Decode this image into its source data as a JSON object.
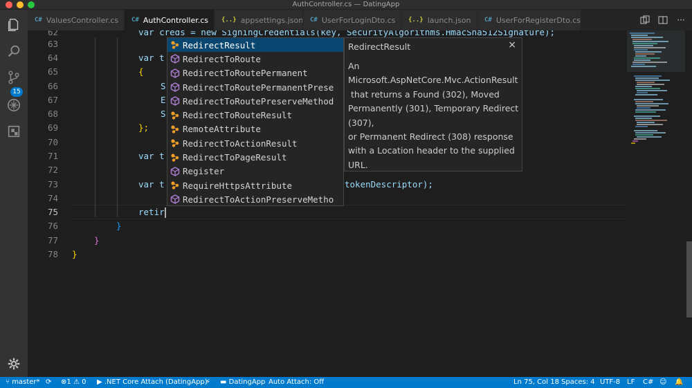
{
  "window": {
    "title": "AuthController.cs — DatingApp"
  },
  "activity_bar": {
    "items": [
      {
        "icon": "files-icon"
      },
      {
        "icon": "search-icon"
      },
      {
        "icon": "source-control-icon",
        "badge": "15"
      },
      {
        "icon": "debug-icon"
      },
      {
        "icon": "extensions-icon"
      }
    ],
    "settings_icon": "gear-icon"
  },
  "tabs": [
    {
      "label": "ValuesController.cs",
      "type": "C#",
      "active": false
    },
    {
      "label": "AuthController.cs",
      "type": "C#",
      "active": true
    },
    {
      "label": "appsettings.json",
      "type": "{..}",
      "active": false
    },
    {
      "label": "UserForLoginDto.cs",
      "type": "C#",
      "active": false
    },
    {
      "label": "launch.json",
      "type": "{..}",
      "active": false
    },
    {
      "label": "UserForRegisterDto.cs",
      "type": "C#",
      "active": false
    }
  ],
  "editor": {
    "line_numbers": [
      "62",
      "63",
      "64",
      "65",
      "66",
      "67",
      "68",
      "69",
      "70",
      "71",
      "72",
      "73",
      "74",
      "75",
      "76",
      "77",
      "78"
    ],
    "current_line": "75",
    "code": {
      "l62": "var creds = new SigningCredentials(key, SecurityAlgorithms.HmacSha512Signature);",
      "l64_a": "var t",
      "l65_a": "S",
      "l66_a": "E",
      "l67_a": "S",
      "l68_a": "};",
      "l70_a": "var t",
      "l72_a": "var t",
      "l72_b": "tokenDescriptor);",
      "l74_a": "retir",
      "l75_a": "}",
      "l76_a": "}",
      "l77_a": "}",
      "brace_open": "{"
    }
  },
  "suggestions": [
    {
      "label": "RedirectResult",
      "kind": "class",
      "selected": true
    },
    {
      "label": "RedirectToRoute",
      "kind": "method",
      "selected": false
    },
    {
      "label": "RedirectToRoutePermanent",
      "kind": "method",
      "selected": false
    },
    {
      "label": "RedirectToRoutePermanentPrese",
      "kind": "method",
      "selected": false
    },
    {
      "label": "RedirectToRoutePreserveMethod",
      "kind": "method",
      "selected": false
    },
    {
      "label": "RedirectToRouteResult",
      "kind": "class",
      "selected": false
    },
    {
      "label": "RemoteAttribute",
      "kind": "class",
      "selected": false
    },
    {
      "label": "RedirectToActionResult",
      "kind": "class",
      "selected": false
    },
    {
      "label": "RedirectToPageResult",
      "kind": "class",
      "selected": false
    },
    {
      "label": "Register",
      "kind": "method",
      "selected": false
    },
    {
      "label": "RequireHttpsAttribute",
      "kind": "class",
      "selected": false
    },
    {
      "label": "RedirectToActionPreserveMetho",
      "kind": "method",
      "selected": false
    }
  ],
  "docs": {
    "title": "RedirectResult",
    "close_label": "×",
    "lines": [
      "An",
      "Microsoft.AspNetCore.Mvc.ActionResult",
      " that returns a Found (302), Moved",
      "Permanently (301), Temporary Redirect",
      "(307),",
      "or Permanent Redirect (308) response",
      "with a Location header to the supplied",
      "URL."
    ]
  },
  "status_bar": {
    "branch": "master*",
    "errors": "1",
    "warnings": "0",
    "debug_target": ".NET Core Attach (DatingApp)",
    "project": "DatingApp",
    "auto_attach": "Auto Attach: Off",
    "position": "Ln 75, Col 18",
    "spaces": "Spaces: 4",
    "encoding": "UTF-8",
    "eol": "LF",
    "language": "C#"
  },
  "colors": {
    "accent": "#007acc",
    "editor_bg": "#1e1e1e",
    "selection": "#094771",
    "keyword": "#569cd6",
    "variable": "#9cdcfe"
  }
}
